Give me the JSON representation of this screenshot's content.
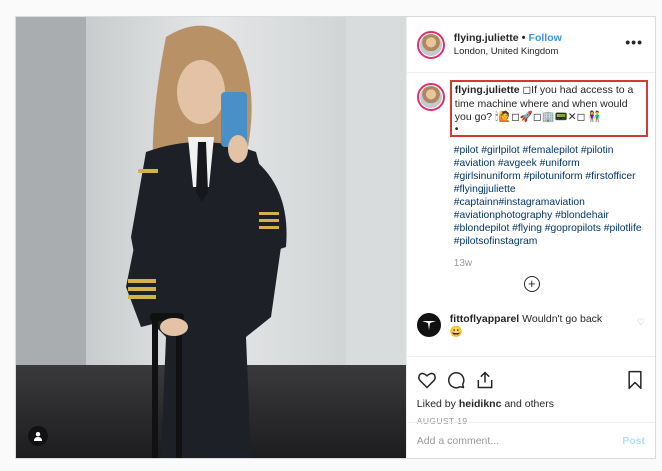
{
  "post": {
    "username": "flying.juliette",
    "dot": "•",
    "follow_label": "Follow",
    "location": "London, United Kingdom",
    "more_icon": "•••",
    "caption_user": "flying.juliette",
    "caption_text": "◻If you had access to a time machine where and when would you go? 🕯🙋◻🚀◻🏢📟✕◻ 👫",
    "caption_trailing": "•",
    "hashtags": "#pilot #girlpilot #femalepilot #pilotin #aviation #avgeek #uniform #girlsinuniform #pilotuniform #firstofficer #flyingjjuliette #captainn#instagramaviation #aviationphotography #blondehair #blondepilot #flying #gopropilots #pilotlife #pilotsofinstagram",
    "time_ago": "13w",
    "load_more_icon": "+",
    "reply_user": "fittoflyapparel",
    "reply_text": "Wouldn't go back",
    "reply_emoji": "😀",
    "reply_heart": "♡",
    "liked_prefix": "Liked by",
    "liked_user": "heidiknc",
    "liked_suffix": "and others",
    "date": "AUGUST 19",
    "add_comment_placeholder": "Add a comment...",
    "post_label": "Post",
    "tag_icon": "user-tag-icon"
  },
  "colors": {
    "follow": "#3897f0",
    "highlight_box": "#d23a3a",
    "hashtag": "#003569",
    "post_disabled": "#b2dffc"
  }
}
